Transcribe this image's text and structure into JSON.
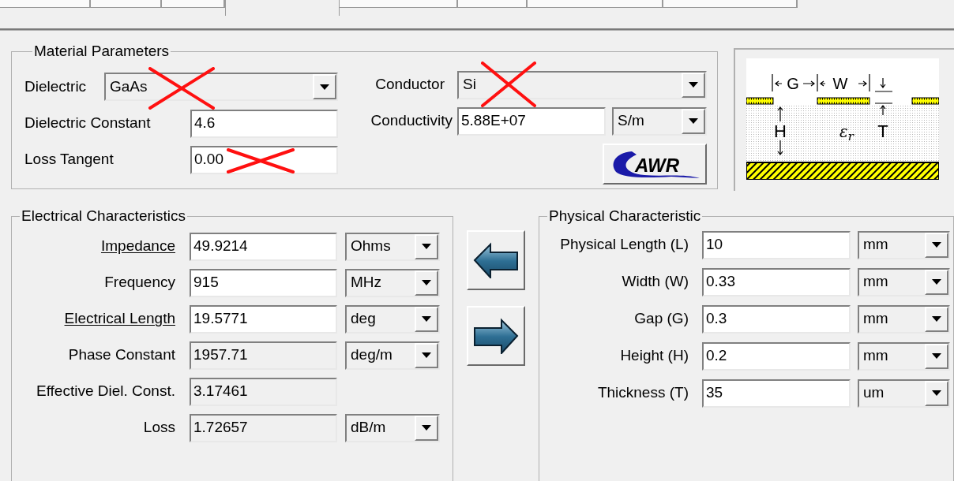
{
  "tabs": [
    {
      "selected": false
    },
    {
      "selected": false
    },
    {
      "selected": false
    },
    {
      "selected": true
    },
    {
      "selected": false
    },
    {
      "selected": false
    },
    {
      "selected": false
    },
    {
      "selected": false
    }
  ],
  "material": {
    "title": "Material Parameters",
    "dielectric": {
      "label": "Dielectric",
      "value": "GaAs",
      "struck": true
    },
    "dielectric_constant": {
      "label": "Dielectric Constant",
      "value": "4.6",
      "struck": false
    },
    "loss_tangent": {
      "label": "Loss Tangent",
      "value": "0.00",
      "struck": true
    },
    "conductor": {
      "label": "Conductor",
      "value": "Si",
      "struck": true
    },
    "conductivity": {
      "label": "Conductivity",
      "value": "5.88E+07",
      "unit": "S/m"
    },
    "logo": {
      "text": "AWR"
    }
  },
  "diagram": {
    "gap": "G",
    "width": "W",
    "thickness": "T",
    "height": "H",
    "permittivity": "ε",
    "permittivity_index": "r"
  },
  "electrical": {
    "title": "Electrical Characteristics",
    "rows": [
      {
        "label": "Impedance",
        "value": "49.9214",
        "unit": "Ohms",
        "underlined": true,
        "readonly": false
      },
      {
        "label": "Frequency",
        "value": "915",
        "unit": "MHz",
        "underlined": false,
        "readonly": false
      },
      {
        "label": "Electrical Length",
        "value": "19.5771",
        "unit": "deg",
        "underlined": true,
        "readonly": false
      },
      {
        "label": "Phase Constant",
        "value": "1957.71",
        "unit": "deg/m",
        "underlined": false,
        "readonly": true
      },
      {
        "label": "Effective Diel. Const.",
        "value": "3.17461",
        "underlined": false,
        "readonly": true
      },
      {
        "label": "Loss",
        "value": "1.72657",
        "unit": "dB/m",
        "underlined": false,
        "readonly": true
      }
    ]
  },
  "physical": {
    "title": "Physical Characteristic",
    "rows": [
      {
        "label": "Physical Length (L)",
        "value": "10",
        "unit": "mm"
      },
      {
        "label": "Width (W)",
        "value": "0.33",
        "unit": "mm"
      },
      {
        "label": "Gap (G)",
        "value": "0.3",
        "unit": "mm"
      },
      {
        "label": "Height (H)",
        "value": "0.2",
        "unit": "mm"
      },
      {
        "label": "Thickness (T)",
        "value": "35",
        "unit": "um"
      }
    ]
  }
}
